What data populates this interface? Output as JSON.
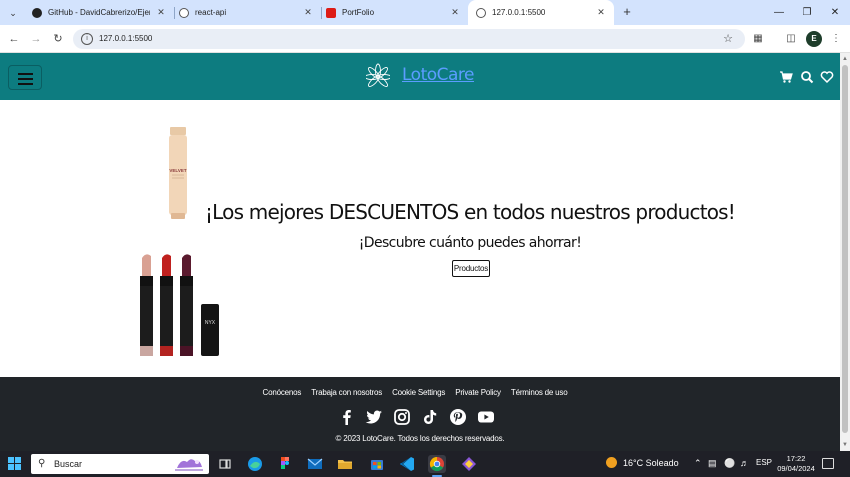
{
  "browser": {
    "tabs": [
      {
        "title": "GitHub - DavidCabrerizo/Ejercic",
        "favicon": "github-icon",
        "active": false
      },
      {
        "title": "react-api",
        "favicon": "globe-icon",
        "active": false
      },
      {
        "title": "PortFolio",
        "favicon": "angular-icon",
        "active": false
      },
      {
        "title": "127.0.0.1:5500",
        "favicon": "globe-icon",
        "active": true
      }
    ],
    "new_tab_label": "+",
    "url": "127.0.0.1:5500",
    "profile_initial": "E"
  },
  "site": {
    "brand": "LotoCare",
    "accent_color": "#0d7c80",
    "hero": {
      "title": "¡Los mejores DESCUENTOS en todos nuestros productos!",
      "subtitle": "¡Descubre cuánto puedes ahorrar!",
      "button_label": "Productos",
      "product_label": "VELVET"
    },
    "footer": {
      "links": [
        "Conócenos",
        "Trabaja con nosotros",
        "Cookie Settings",
        "Private Policy",
        "Términos de uso"
      ],
      "social": [
        "facebook-icon",
        "twitter-icon",
        "instagram-icon",
        "tiktok-icon",
        "pinterest-icon",
        "youtube-icon"
      ],
      "copyright": "© 2023 LotoCare. Todos los derechos reservados."
    }
  },
  "taskbar": {
    "search_placeholder": "Buscar",
    "weather": "16°C  Soleado",
    "language": "ESP",
    "time": "17:22",
    "date": "09/04/2024"
  }
}
